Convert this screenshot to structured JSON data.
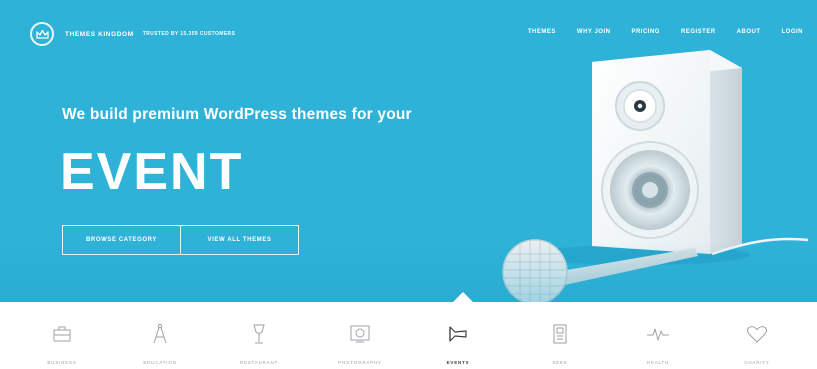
{
  "brand": {
    "name": "Themes Kingdom",
    "tagline": "Trusted by 15,359 customers",
    "icon": "crown-logo-icon"
  },
  "nav": {
    "items": [
      {
        "label": "Themes"
      },
      {
        "label": "Why join"
      },
      {
        "label": "Pricing"
      },
      {
        "label": "Register"
      },
      {
        "label": "About"
      },
      {
        "label": "Login"
      }
    ]
  },
  "hero": {
    "headline": "We build premium WordPress themes for your",
    "big_word": "EVENT",
    "buttons": [
      {
        "label": "Browse category"
      },
      {
        "label": "View all themes"
      }
    ],
    "background_color": "#2fb2d8"
  },
  "categories": {
    "active_index": 4,
    "items": [
      {
        "label": "Business",
        "icon": "briefcase-icon"
      },
      {
        "label": "Education",
        "icon": "compass-icon"
      },
      {
        "label": "Restaurant",
        "icon": "wine-glass-icon"
      },
      {
        "label": "Photography",
        "icon": "photo-icon"
      },
      {
        "label": "Events",
        "icon": "megaphone-icon"
      },
      {
        "label": "Seek",
        "icon": "document-icon"
      },
      {
        "label": "Health",
        "icon": "heartbeat-icon"
      },
      {
        "label": "Charity",
        "icon": "heart-icon"
      }
    ]
  }
}
